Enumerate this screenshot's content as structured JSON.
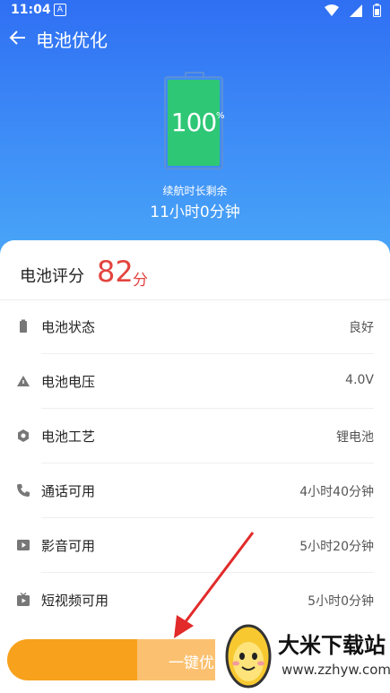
{
  "status_bar": {
    "time": "11:04",
    "notification_letter": "A"
  },
  "app_bar": {
    "title": "电池优化"
  },
  "battery": {
    "percent": "100",
    "percent_sign": "%",
    "level": 1.0
  },
  "remaining": {
    "label": "续航时长剩余",
    "value": "11小时0分钟"
  },
  "score": {
    "label": "电池评分",
    "value": "82",
    "unit": "分"
  },
  "rows": [
    {
      "icon": "battery-icon",
      "label": "电池状态",
      "value": "良好"
    },
    {
      "icon": "warning-triangle-icon",
      "label": "电池电压",
      "value": "4.0V"
    },
    {
      "icon": "hexagon-icon",
      "label": "电池工艺",
      "value": "锂电池"
    },
    {
      "icon": "phone-icon",
      "label": "通话可用",
      "value": "4小时40分钟"
    },
    {
      "icon": "play-icon",
      "label": "影音可用",
      "value": "5小时20分钟"
    },
    {
      "icon": "short-video-icon",
      "label": "短视频可用",
      "value": "5小时0分钟"
    }
  ],
  "button": {
    "label": "一键优"
  },
  "watermark": {
    "name": "大米下载站",
    "url": "www.zzhyw.com"
  },
  "colors": {
    "header": "#2f6ff3",
    "score": "#e3443e",
    "button": "#f7a11c",
    "battery_fill": "#2ec776"
  }
}
